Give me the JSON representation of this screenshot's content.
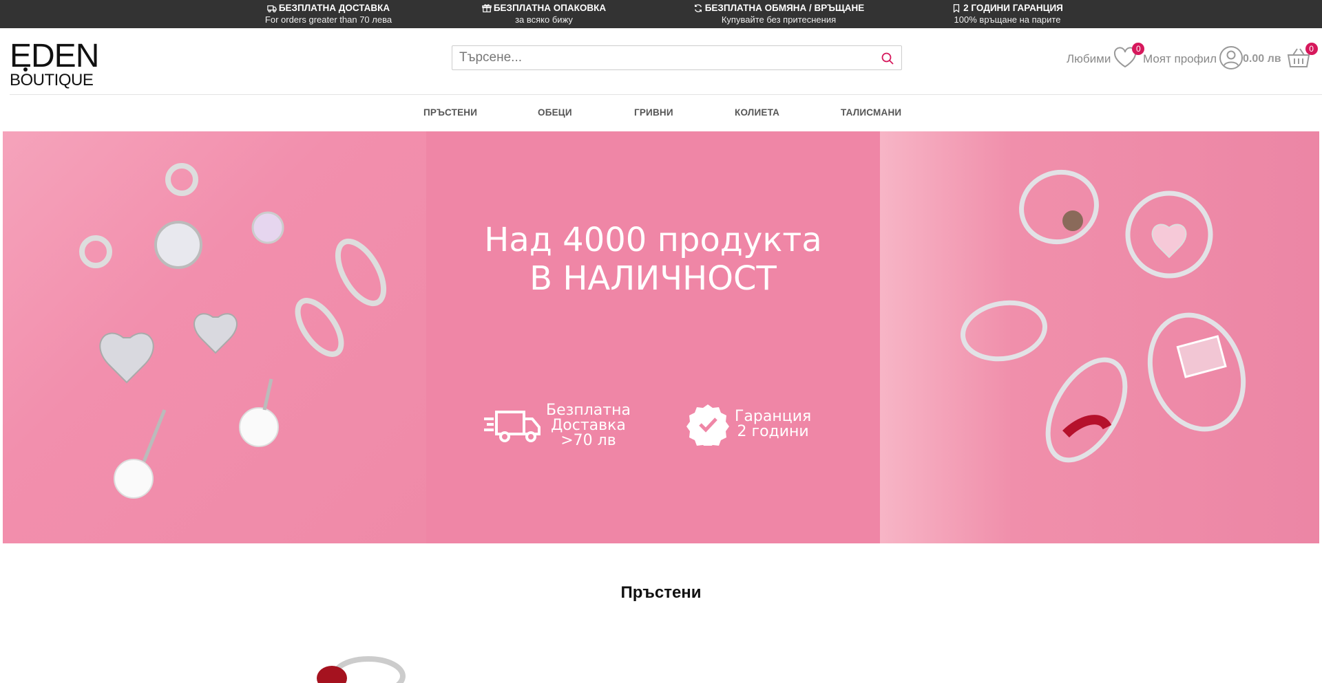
{
  "topbar": {
    "perks": [
      {
        "icon": "truck-icon",
        "title": "БЕЗПЛАТНА ДОСТАВКА",
        "sub": "For orders greater than 70 лева"
      },
      {
        "icon": "gift-icon",
        "title": "БЕЗПЛАТНА ОПАКОВКА",
        "sub": "за всяко бижу"
      },
      {
        "icon": "refresh-icon",
        "title": "БЕЗПЛАТНА ОБМЯНА / ВРЪЩАНЕ",
        "sub": "Купувайте без притеснения"
      },
      {
        "icon": "bookmark-icon",
        "title": "2 ГОДИНИ ГАРАНЦИЯ",
        "sub": "100% връщане на парите"
      }
    ]
  },
  "header": {
    "logo_line1": "EDEN",
    "logo_line2": "BOUTIQUE",
    "search": {
      "placeholder": "Търсене..."
    },
    "favorites": {
      "label": "Любими",
      "count": "0"
    },
    "profile": {
      "label": "Моят профил"
    },
    "cart": {
      "amount": "0.00 лв",
      "count": "0"
    }
  },
  "nav": {
    "items": [
      "ПРЪСТЕНИ",
      "ОБЕЦИ",
      "ГРИВНИ",
      "КОЛИЕТА",
      "ТАЛИСМАНИ"
    ]
  },
  "banner": {
    "headline1": "Над 4000 продукта",
    "headline2": "В НАЛИЧНОСТ",
    "feature1": {
      "line1": "Безплатна",
      "line2": "Доставка",
      "line3": ">70 лв"
    },
    "feature2": {
      "line1": "Гаранция",
      "line2": "2 години"
    }
  },
  "section": {
    "title": "Пръстени"
  },
  "colors": {
    "accent": "#d6185c",
    "topbar": "#333333",
    "banner": "#ef86a6"
  }
}
